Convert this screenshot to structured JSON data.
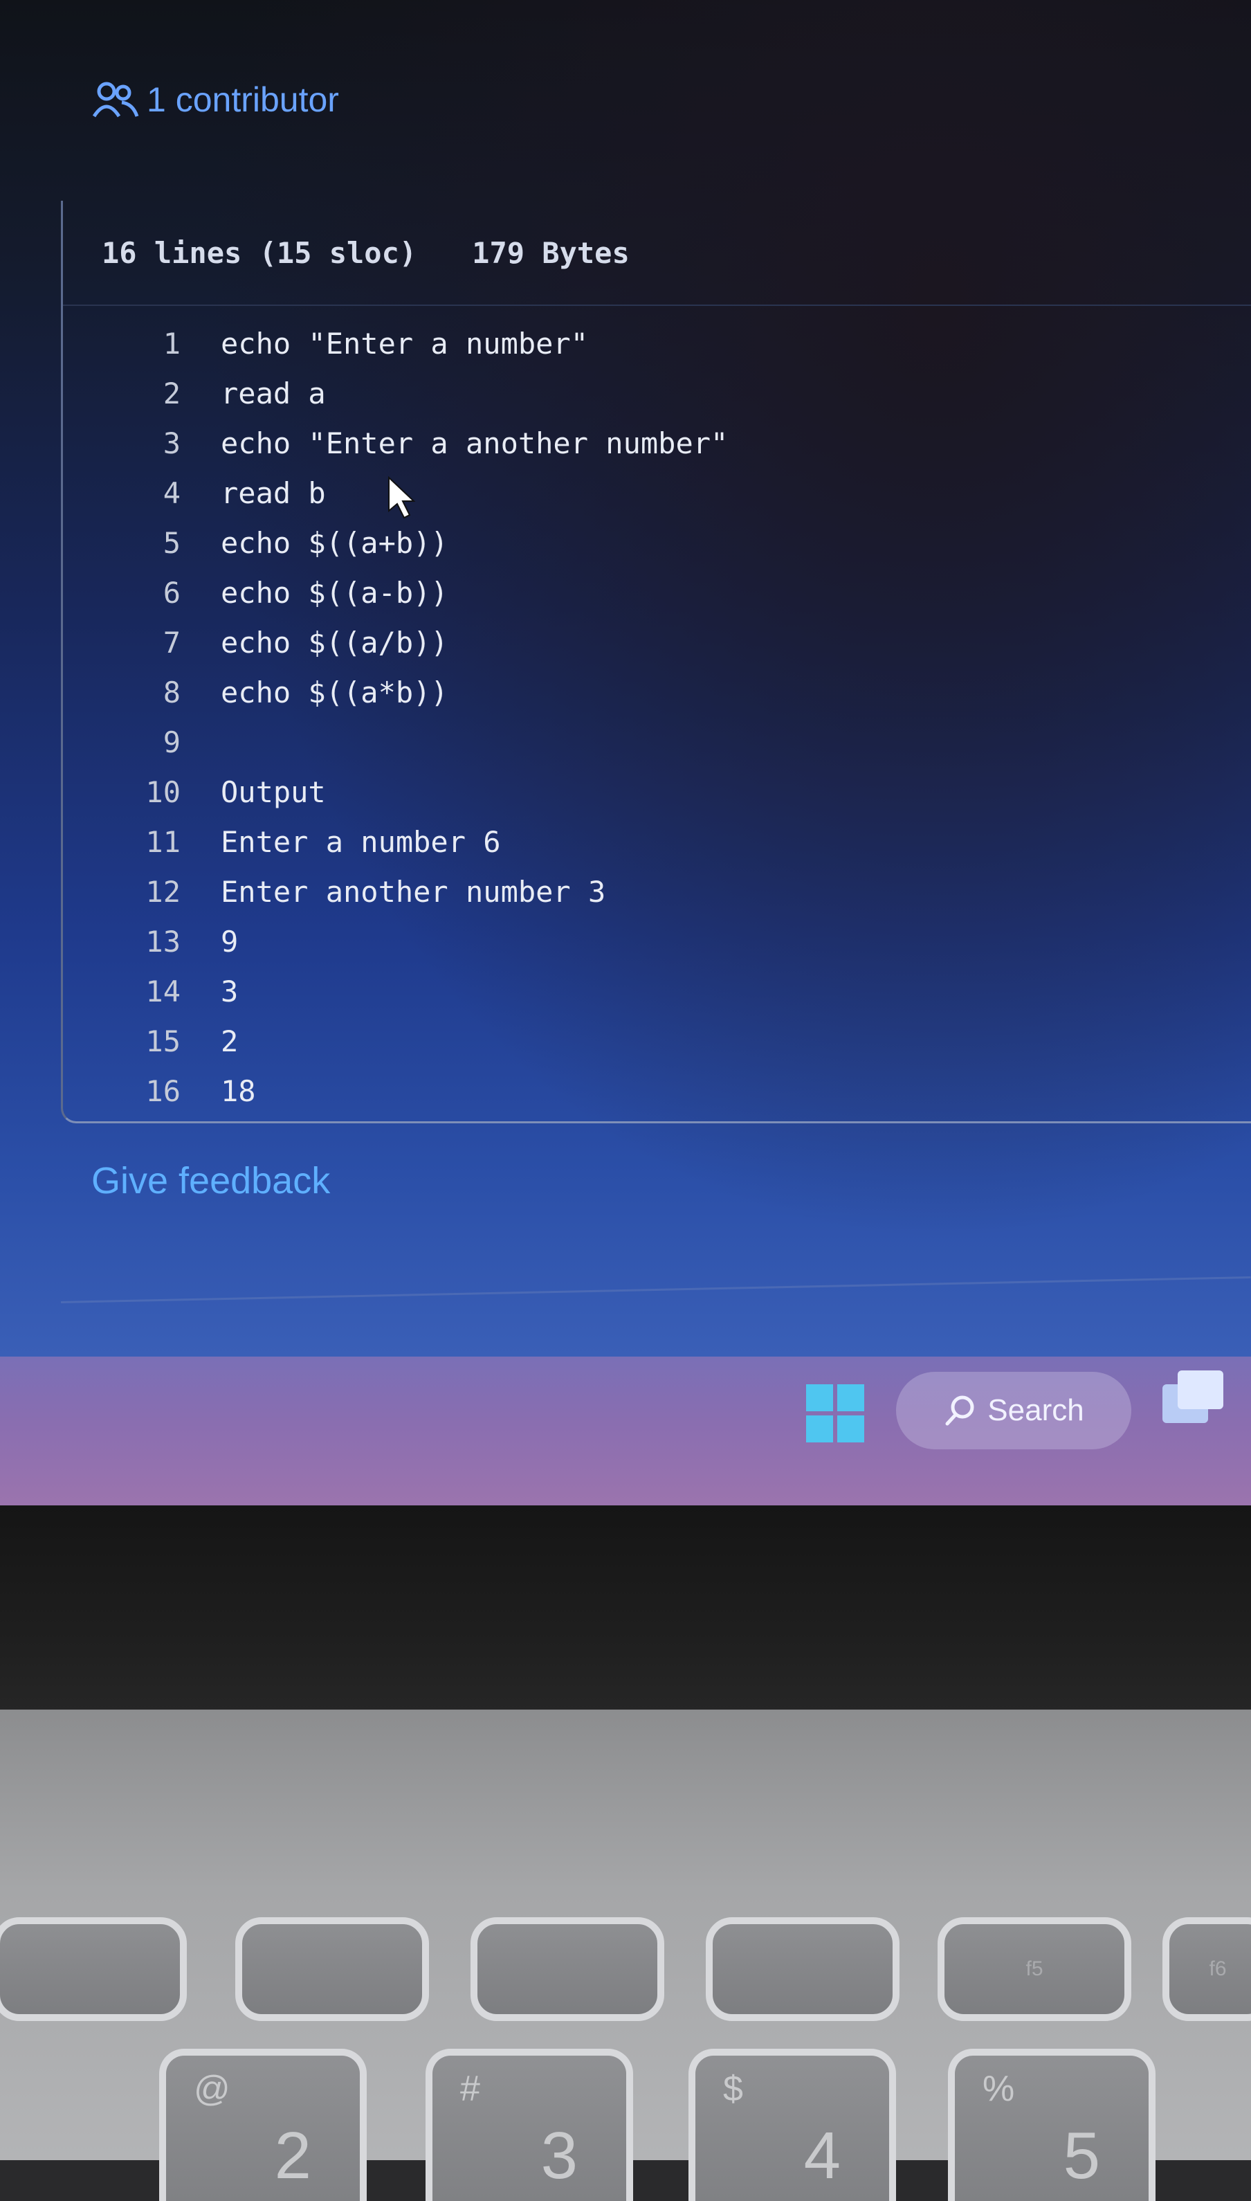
{
  "header": {
    "contributors_label": "1 contributor"
  },
  "file": {
    "lines_info": "16 lines (15 sloc)",
    "size_info": "179 Bytes"
  },
  "code_lines": [
    {
      "n": "1",
      "text": "echo \"Enter a number\""
    },
    {
      "n": "2",
      "text": "read a"
    },
    {
      "n": "3",
      "text": "echo \"Enter a another number\""
    },
    {
      "n": "4",
      "text": "read b"
    },
    {
      "n": "5",
      "text": "echo $((a+b))"
    },
    {
      "n": "6",
      "text": "echo $((a-b))"
    },
    {
      "n": "7",
      "text": "echo $((a/b))"
    },
    {
      "n": "8",
      "text": "echo $((a*b))"
    },
    {
      "n": "9",
      "text": ""
    },
    {
      "n": "10",
      "text": "Output"
    },
    {
      "n": "11",
      "text": "Enter a number 6"
    },
    {
      "n": "12",
      "text": "Enter another number 3"
    },
    {
      "n": "13",
      "text": "9"
    },
    {
      "n": "14",
      "text": "3"
    },
    {
      "n": "15",
      "text": "2"
    },
    {
      "n": "16",
      "text": "18"
    }
  ],
  "footer": {
    "feedback_link": "Give feedback"
  },
  "taskbar": {
    "search_label": "Search"
  },
  "keyboard": {
    "number_keys": [
      {
        "sym": "@",
        "num": "2"
      },
      {
        "sym": "#",
        "num": "3"
      },
      {
        "sym": "$",
        "num": "4"
      },
      {
        "sym": "%",
        "num": "5"
      }
    ],
    "fn_keys": [
      "",
      "",
      "",
      "",
      "f5",
      "f6"
    ]
  },
  "colors": {
    "link": "#5fb0ff",
    "start_tiles": "#4fc6f0"
  }
}
